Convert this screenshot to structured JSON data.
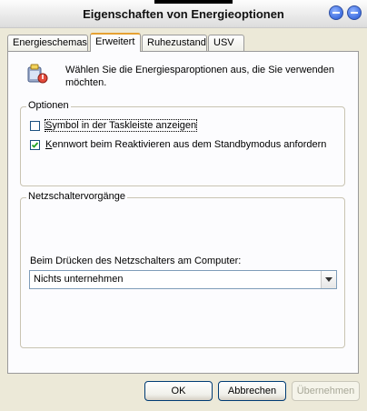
{
  "window": {
    "title": "Eigenschaften von Energieoptionen"
  },
  "tabs": [
    {
      "label": "Energieschemas",
      "active": false
    },
    {
      "label": "Erweitert",
      "active": true
    },
    {
      "label": "Ruhezustand",
      "active": false
    },
    {
      "label": "USV",
      "active": false
    }
  ],
  "info": {
    "text": "Wählen Sie die Energiesparoptionen aus, die Sie verwenden möchten.",
    "icon": "power-options-icon"
  },
  "options_group": {
    "label": "Optionen",
    "items": [
      {
        "label": "Symbol in der Taskleiste anzeigen",
        "checked": false,
        "focused": true
      },
      {
        "label": "Kennwort beim Reaktivieren aus dem Standbymodus anfordern",
        "checked": true,
        "focused": false
      }
    ]
  },
  "power_button_group": {
    "label": "Netzschaltervorgänge",
    "prompt": "Beim Drücken des Netzschalters am Computer:",
    "selected": "Nichts unternehmen"
  },
  "buttons": {
    "ok": "OK",
    "cancel": "Abbrechen",
    "apply": "Übernehmen"
  },
  "colors": {
    "accent_tab": "#e6a133",
    "title_buttons": "#3f6fe0"
  }
}
